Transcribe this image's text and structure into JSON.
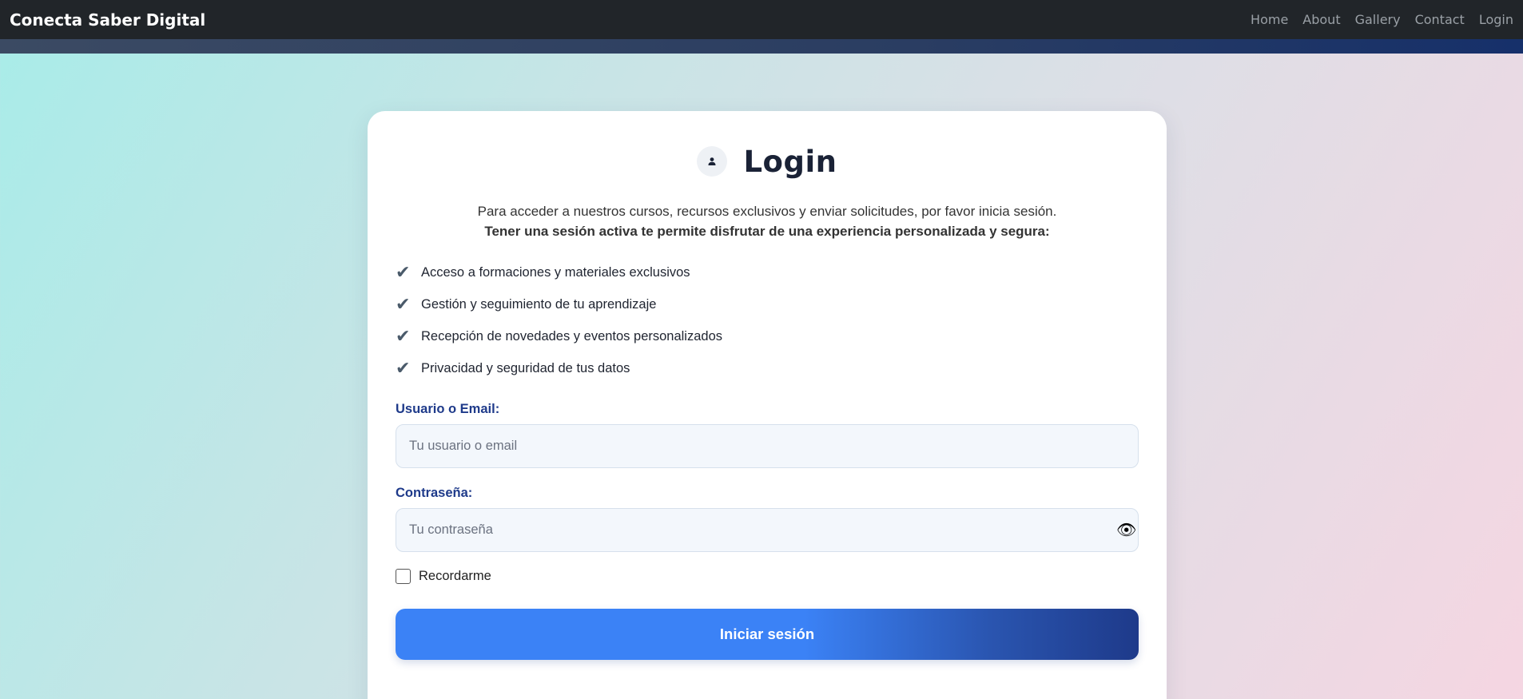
{
  "navbar": {
    "brand": "Conecta Saber Digital",
    "links": [
      "Home",
      "About",
      "Gallery",
      "Contact",
      "Login"
    ]
  },
  "login": {
    "title": "Login",
    "intro_text": "Para acceder a nuestros cursos, recursos exclusivos y enviar solicitudes, por favor inicia sesión.",
    "intro_bold": "Tener una sesión activa te permite disfrutar de una experiencia personalizada y segura:",
    "check_glyph": "✔",
    "benefits": [
      "Acceso a formaciones y materiales exclusivos",
      "Gestión y seguimiento de tu aprendizaje",
      "Recepción de novedades y eventos personalizados",
      "Privacidad y seguridad de tus datos"
    ],
    "username_label": "Usuario o Email:",
    "username_placeholder": "Tu usuario o email",
    "username_value": "",
    "password_label": "Contraseña:",
    "password_placeholder": "Tu contraseña",
    "password_value": "",
    "show_password_icon": "eye-icon",
    "remember_label": "Recordarme",
    "remember_checked": false,
    "submit_label": "Iniciar sesión"
  },
  "colors": {
    "navbar_bg": "#212529",
    "accent_blue": "#3b82f6",
    "accent_dark_blue": "#1e3a8a",
    "label_blue": "#1e3a8a"
  }
}
